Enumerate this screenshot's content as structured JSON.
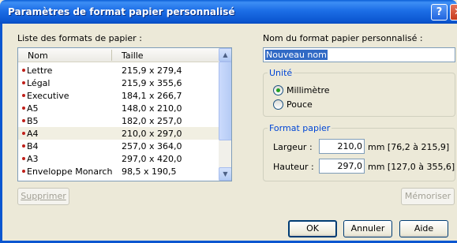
{
  "window": {
    "title": "Paramètres de format papier personnalisé",
    "help_glyph": "?",
    "close_glyph": "✕"
  },
  "list": {
    "label": "Liste des formats de papier :",
    "columns": [
      "Nom",
      "Taille"
    ],
    "rows": [
      {
        "name": "Lettre",
        "size": "215,9 x 279,4"
      },
      {
        "name": "Légal",
        "size": "215,9 x 355,6"
      },
      {
        "name": "Executive",
        "size": "184,1 x 266,7"
      },
      {
        "name": "A5",
        "size": "148,0 x 210,0"
      },
      {
        "name": "B5",
        "size": "182,0 x 257,0"
      },
      {
        "name": "A4",
        "size": "210,0 x 297,0"
      },
      {
        "name": "B4",
        "size": "257,0 x 364,0"
      },
      {
        "name": "A3",
        "size": "297,0 x 420,0"
      },
      {
        "name": "Enveloppe Monarch",
        "size": "98,5 x 190,5"
      }
    ],
    "selected_row": "A4",
    "delete_button": "Supprimer"
  },
  "custom_name": {
    "label": "Nom du format papier personnalisé :",
    "value": "Nouveau nom"
  },
  "unit": {
    "title": "Unité",
    "options": [
      "Millimètre",
      "Pouce"
    ],
    "selected": "Millimètre"
  },
  "paper_format": {
    "title": "Format papier",
    "width_label": "Largeur :",
    "width_value": "210,0",
    "width_range": "mm [76,2 à 215,9]",
    "height_label": "Hauteur :",
    "height_value": "297,0",
    "height_range": "mm [127,0 à 355,6]"
  },
  "buttons": {
    "save": "Mémoriser",
    "ok": "OK",
    "cancel": "Annuler",
    "help": "Aide"
  },
  "colors": {
    "titlebar": "#0b56d0",
    "dialog_bg": "#ece9d8",
    "group_title": "#0046d5",
    "bullet": "#c0201a",
    "selection": "#316ac5"
  }
}
